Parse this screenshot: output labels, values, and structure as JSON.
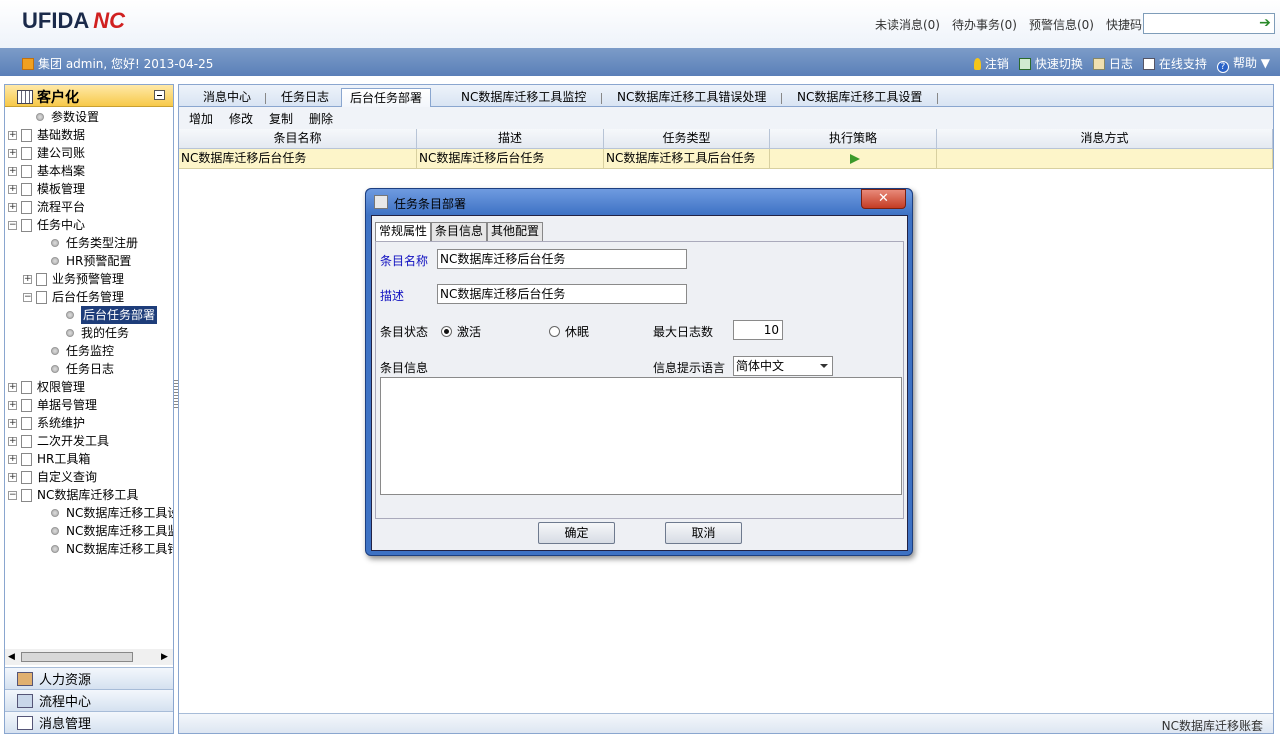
{
  "header": {
    "logo_text": "UFIDA",
    "logo_mark": "NC",
    "links": [
      "未读消息(0)",
      "待办事务(0)",
      "预警信息(0)",
      "快捷码"
    ],
    "quick_code_value": ""
  },
  "bluebar": {
    "welcome": "集团 admin, 您好! 2013-04-25",
    "links": [
      "注销",
      "快速切换",
      "日志",
      "在线支持",
      "帮助"
    ]
  },
  "left_panel": {
    "title": "客户化",
    "tree": [
      {
        "label": "参数设置",
        "level": 1,
        "type": "leaf"
      },
      {
        "label": "基础数据",
        "level": 0,
        "type": "folder"
      },
      {
        "label": "建公司账",
        "level": 0,
        "type": "folder"
      },
      {
        "label": "基本档案",
        "level": 0,
        "type": "folder"
      },
      {
        "label": "模板管理",
        "level": 0,
        "type": "folder"
      },
      {
        "label": "流程平台",
        "level": 0,
        "type": "folder"
      },
      {
        "label": "任务中心",
        "level": 0,
        "type": "folder-open"
      },
      {
        "label": "任务类型注册",
        "level": 2,
        "type": "leaf"
      },
      {
        "label": "HR预警配置",
        "level": 2,
        "type": "leaf"
      },
      {
        "label": "业务预警管理",
        "level": 1,
        "type": "folder"
      },
      {
        "label": "后台任务管理",
        "level": 1,
        "type": "folder-open"
      },
      {
        "label": "后台任务部署",
        "level": 3,
        "type": "leaf",
        "selected": true
      },
      {
        "label": "我的任务",
        "level": 3,
        "type": "leaf"
      },
      {
        "label": "任务监控",
        "level": 2,
        "type": "leaf"
      },
      {
        "label": "任务日志",
        "level": 2,
        "type": "leaf"
      },
      {
        "label": "权限管理",
        "level": 0,
        "type": "folder"
      },
      {
        "label": "单据号管理",
        "level": 0,
        "type": "folder"
      },
      {
        "label": "系统维护",
        "level": 0,
        "type": "folder"
      },
      {
        "label": "二次开发工具",
        "level": 0,
        "type": "folder"
      },
      {
        "label": "HR工具箱",
        "level": 0,
        "type": "folder"
      },
      {
        "label": "自定义查询",
        "level": 0,
        "type": "folder"
      },
      {
        "label": "NC数据库迁移工具",
        "level": 0,
        "type": "folder-open"
      },
      {
        "label": "NC数据库迁移工具设置",
        "level": 2,
        "type": "leaf"
      },
      {
        "label": "NC数据库迁移工具监控",
        "level": 2,
        "type": "leaf"
      },
      {
        "label": "NC数据库迁移工具错误处理",
        "level": 2,
        "type": "leaf"
      }
    ],
    "bottom_buttons": [
      "人力资源",
      "流程中心",
      "消息管理"
    ]
  },
  "main": {
    "tabs": [
      "消息中心",
      "任务日志",
      "后台任务部署",
      "NC数据库迁移工具监控",
      "NC数据库迁移工具错误处理",
      "NC数据库迁移工具设置"
    ],
    "active_tab": 2,
    "toolbar": [
      "增加",
      "修改",
      "复制",
      "删除"
    ],
    "columns": [
      "条目名称",
      "描述",
      "任务类型",
      "执行策略",
      "消息方式"
    ],
    "rows": [
      {
        "name": "NC数据库迁移后台任务",
        "desc": "NC数据库迁移后台任务",
        "type": "NC数据库迁移工具后台任务",
        "strategy": "play-icon",
        "msg": ""
      }
    ],
    "status_text": "NC数据库迁移账套"
  },
  "dialog": {
    "title": "任务条目部署",
    "tabs": [
      "常规属性",
      "条目信息",
      "其他配置"
    ],
    "active_tab": 0,
    "name_label": "条目名称",
    "name_value": "NC数据库迁移后台任务",
    "desc_label": "描述",
    "desc_value": "NC数据库迁移后台任务",
    "status_label": "条目状态",
    "status_options": [
      "激活",
      "休眠"
    ],
    "status_selected": "激活",
    "maxlog_label": "最大日志数",
    "maxlog_value": "10",
    "info_label": "条目信息",
    "lang_label": "信息提示语言",
    "lang_value": "简体中文",
    "info_text": "",
    "ok_label": "确定",
    "cancel_label": "取消"
  }
}
